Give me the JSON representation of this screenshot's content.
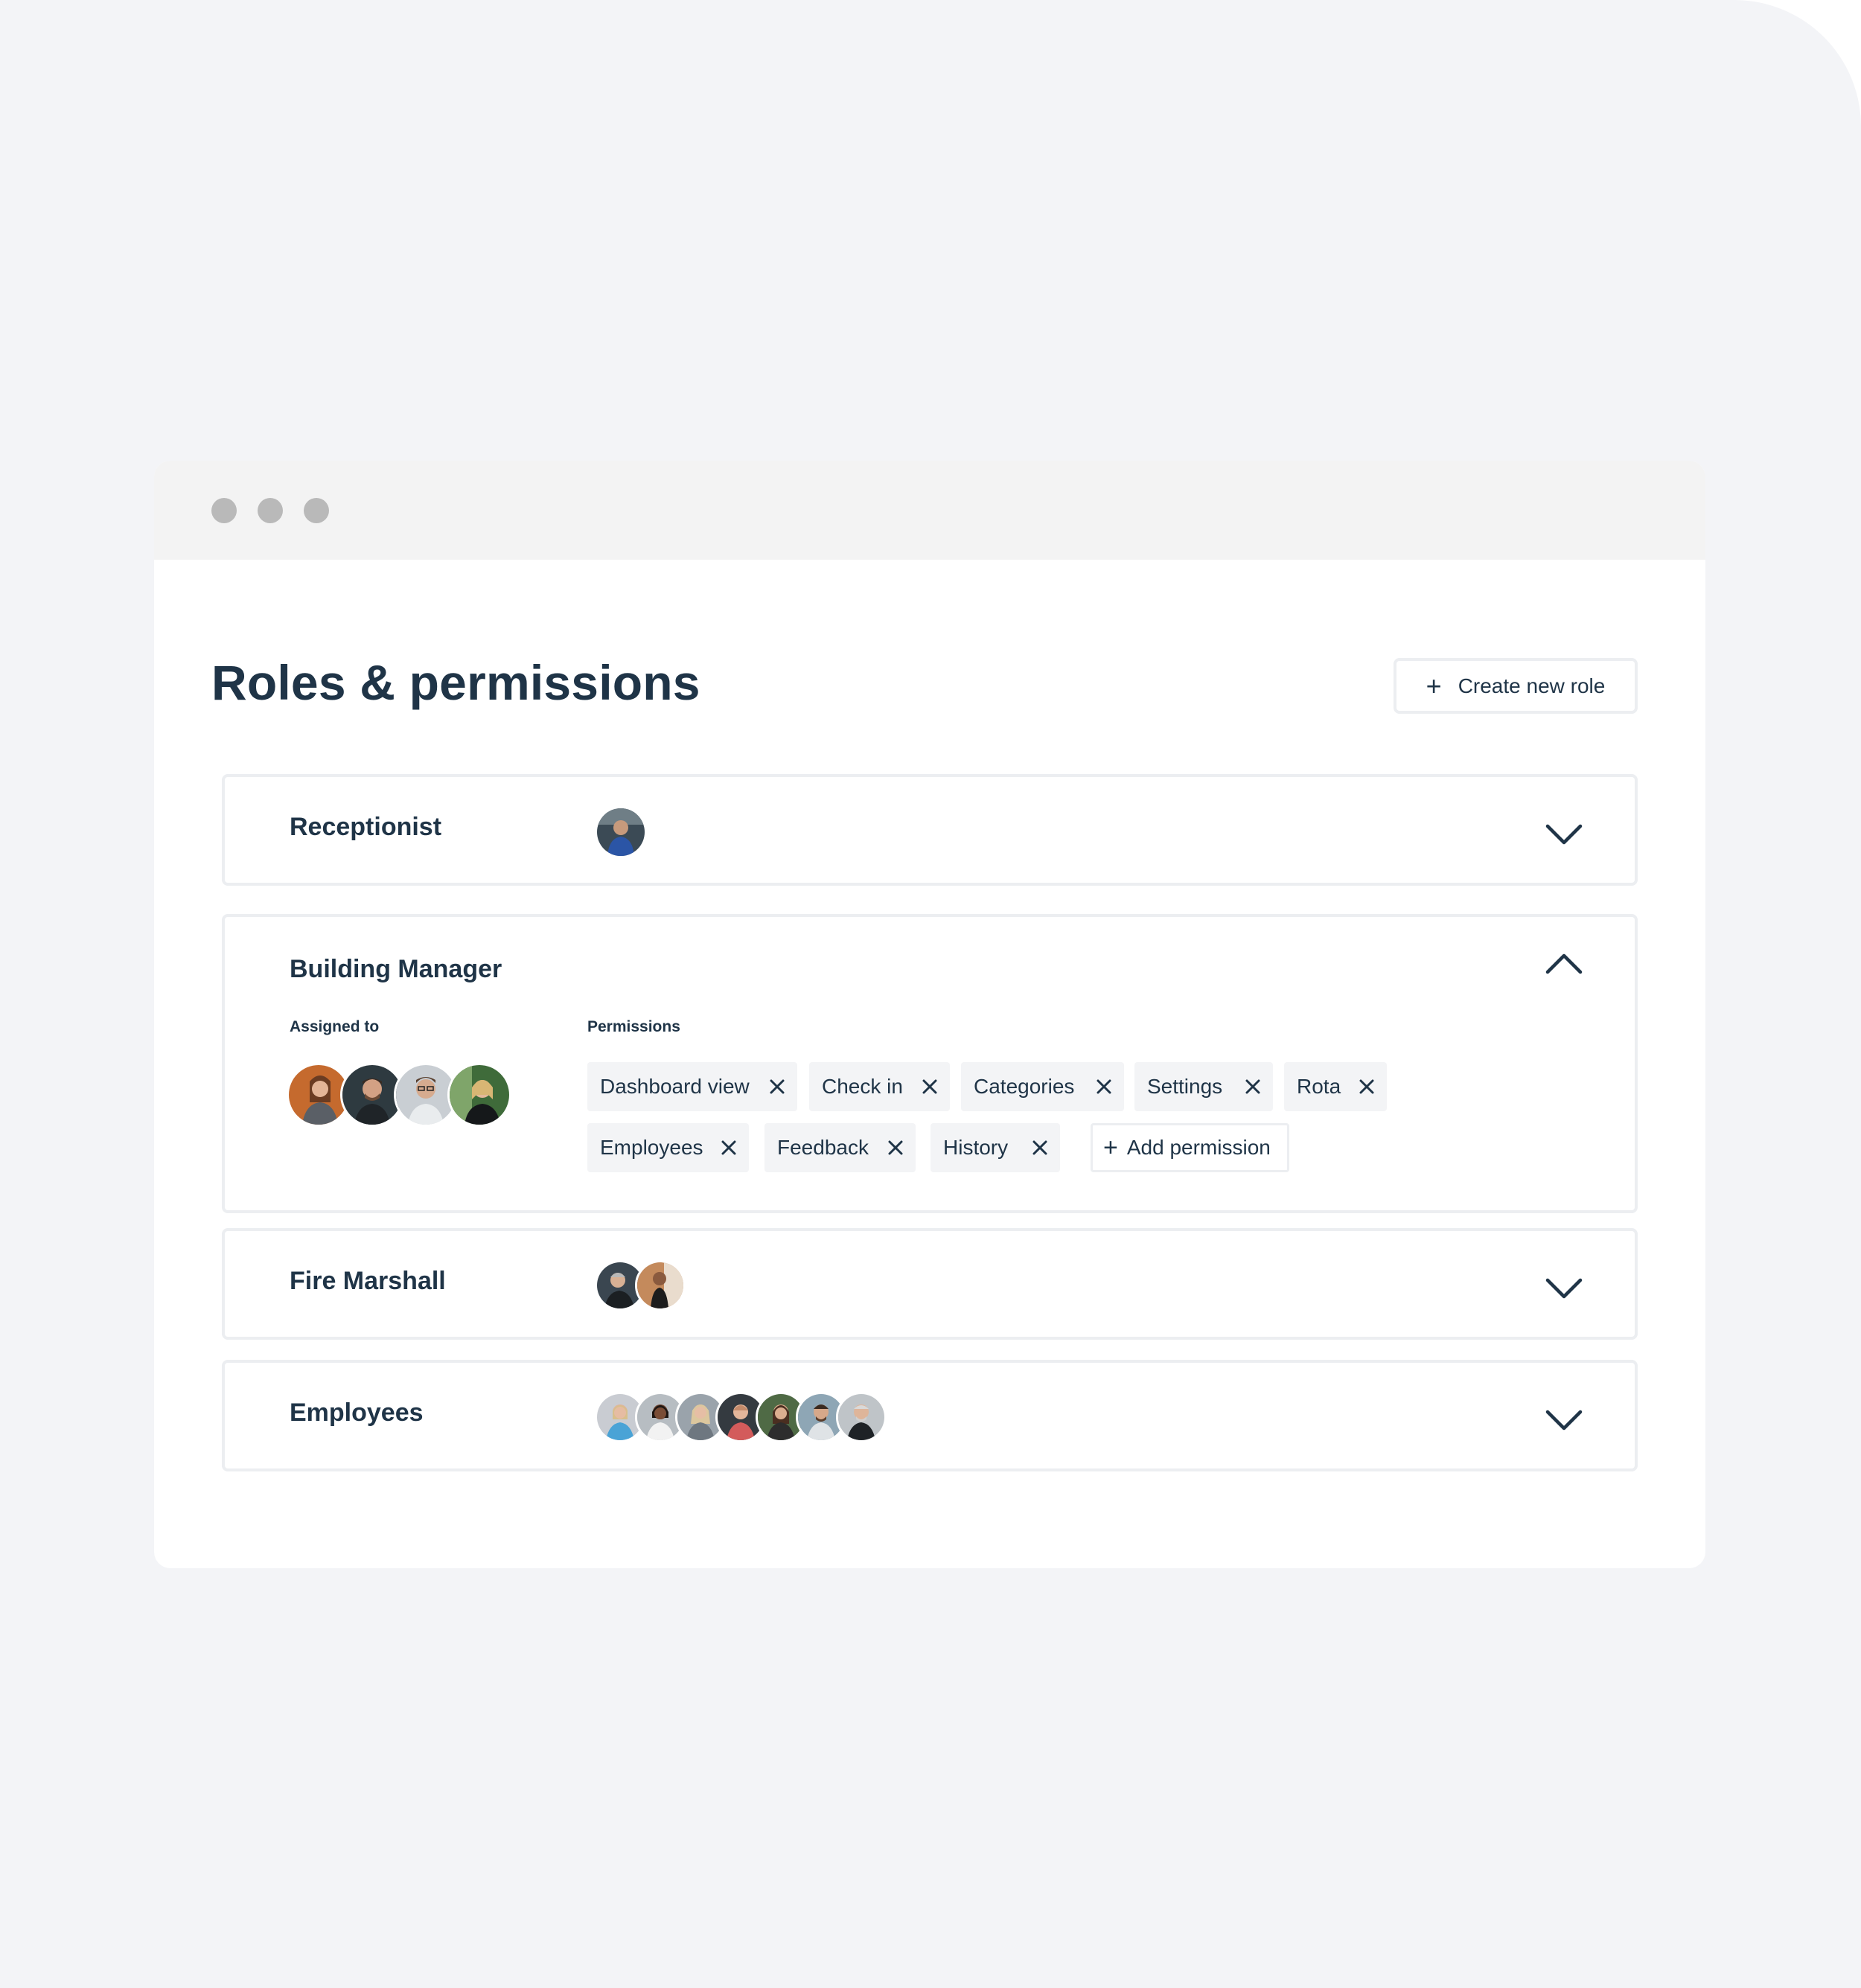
{
  "page": {
    "title": "Roles & permissions",
    "create_button_label": "Create new role"
  },
  "window_controls": [
    "dot-1",
    "dot-2",
    "dot-3"
  ],
  "roles": [
    {
      "name": "Receptionist",
      "expanded": false,
      "avatar_count": 1
    },
    {
      "name": "Building Manager",
      "expanded": true,
      "assigned_label": "Assigned to",
      "permissions_label": "Permissions",
      "avatar_count": 4,
      "permissions": [
        "Dashboard view",
        "Check in",
        "Categories",
        "Settings",
        "Rota",
        "Employees",
        "Feedback",
        "History"
      ],
      "add_permission_label": "Add permission"
    },
    {
      "name": "Fire Marshall",
      "expanded": false,
      "avatar_count": 2
    },
    {
      "name": "Employees",
      "expanded": false,
      "avatar_count": 7
    }
  ],
  "icons": {
    "create": "plus-icon",
    "expand": "chevron-down-icon",
    "collapse": "chevron-up-icon",
    "remove": "close-icon",
    "add": "plus-icon"
  },
  "colors": {
    "text": "#1f3447",
    "page_background": "#f3f4f7",
    "card_border": "#eceef1",
    "chip_background": "#f3f4f6",
    "window_dots": "#b9b9b9"
  }
}
